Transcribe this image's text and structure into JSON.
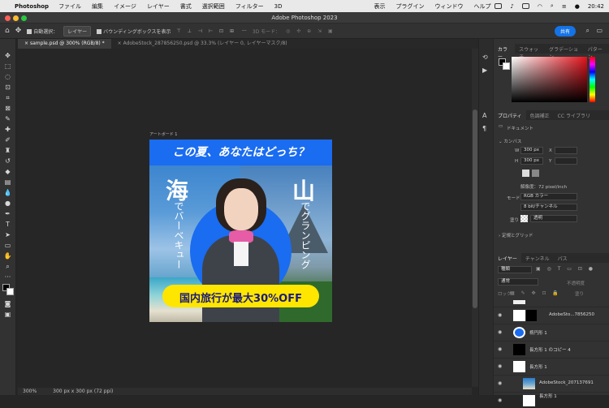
{
  "menubar": {
    "app": "Photoshop",
    "items": [
      "ファイル",
      "編集",
      "イメージ",
      "レイヤー",
      "書式",
      "選択範囲",
      "フィルター",
      "3D",
      "表示",
      "プラグイン",
      "ウィンドウ",
      "ヘルプ"
    ],
    "clock": "20:42"
  },
  "window": {
    "title": "Adobe Photoshop 2023"
  },
  "options": {
    "auto_select_label": "自動選択：",
    "auto_select_value": "レイヤー",
    "bbox_label": "バウンディングボックスを表示",
    "mode3d": "3D モード：",
    "share": "共有"
  },
  "tabs": [
    {
      "label": "sample.psd @ 300% (RGB/8) *"
    },
    {
      "label": "AdobeStock_287856250.psd @ 33.3% (レイヤー 0, レイヤーマスク/8)"
    }
  ],
  "artboard": {
    "label": "アートボード 1",
    "headline": "この夏、あなたはどっち？",
    "left_big": "海",
    "left_small": "でバーベキュー",
    "right_big": "山",
    "right_small": "でグランピング",
    "banner": "国内旅行が最大30%OFF"
  },
  "status": {
    "zoom": "300%",
    "docsize": "300 px x 300 px (72 ppi)"
  },
  "color_panel": {
    "tabs": [
      "カラー",
      "スウォッチ",
      "グラデーション",
      "パターン"
    ]
  },
  "props_panel": {
    "tabs": [
      "プロパティ",
      "色調補正",
      "CC ライブラリ"
    ],
    "doc_label": "ドキュメント",
    "canvas_label": "カンバス",
    "w_label": "W",
    "w_value": "300 px",
    "h_label": "H",
    "h_value": "300 px",
    "x_label": "X",
    "y_label": "Y",
    "resolution": "解像度：72 pixel/inch",
    "mode_label": "モード",
    "mode_value": "RGB カラー",
    "bit_value": "8 bit/チャンネル",
    "fill_label": "塗り",
    "fill_value": "透明",
    "rulers_label": "定規とグリッド"
  },
  "layers_panel": {
    "tabs": [
      "レイヤー",
      "チャンネル",
      "パス"
    ],
    "filter_kind": "種類",
    "mode": "通常",
    "opacity_label": "不透明度",
    "lock_label": "ロック",
    "fill_label": "塗り",
    "layers": [
      {
        "name": "AdobeSto...7856250"
      },
      {
        "name": "楕円形 1"
      },
      {
        "name": "長方形 1 のコピー 4"
      },
      {
        "name": "長方形 1"
      },
      {
        "name": "AdobeStock_207137691"
      },
      {
        "name": "長方形 1"
      }
    ]
  },
  "colors": {
    "accent": "#1473e6",
    "banner_yellow": "#ffe600",
    "circle_blue": "#1a6cf0",
    "fg_red_gradient": "#e3121b"
  }
}
